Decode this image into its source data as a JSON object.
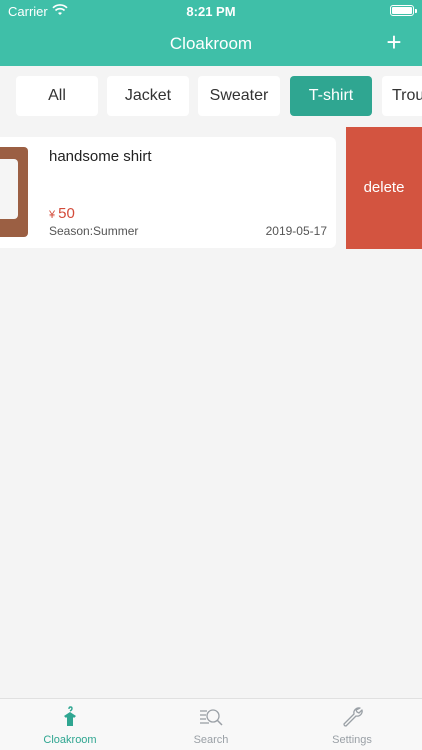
{
  "status_bar": {
    "carrier": "Carrier",
    "time": "8:21 PM"
  },
  "nav": {
    "title": "Cloakroom",
    "add": "+"
  },
  "tabs": [
    {
      "label": "All"
    },
    {
      "label": "Jacket"
    },
    {
      "label": "Sweater"
    },
    {
      "label": "T-shirt",
      "active": true
    },
    {
      "label": "Trou"
    }
  ],
  "item": {
    "name": "handsome shirt",
    "currency": "¥",
    "price": "50",
    "season": "Season:Summer",
    "date": "2019-05-17"
  },
  "swipe_action": {
    "label": "delete"
  },
  "tabbar": {
    "items": [
      {
        "label": "Cloakroom",
        "icon": "hanger-icon",
        "active": true
      },
      {
        "label": "Search",
        "icon": "search-icon"
      },
      {
        "label": "Settings",
        "icon": "wrench-icon"
      }
    ]
  },
  "colors": {
    "primary": "#3fbfa8",
    "active_tab": "#2fa691",
    "delete": "#d35440",
    "price": "#d34b3a"
  }
}
